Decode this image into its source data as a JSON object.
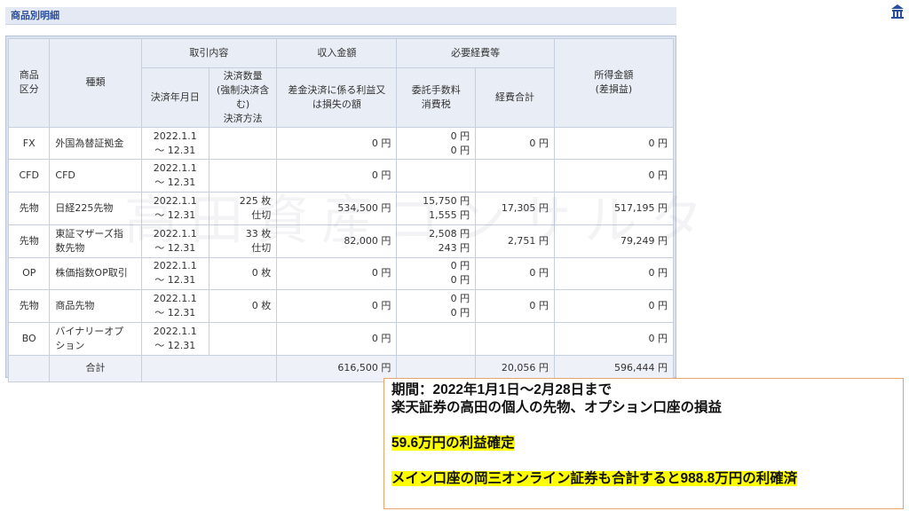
{
  "section_title": "商品別明細",
  "watermark": "高田資産コンサルタ",
  "header": {
    "product_type": "商品\n区分",
    "kind": "種類",
    "trade_content": "取引内容",
    "settle_date": "決済年月日",
    "settle_qty": "決済数量\n(強制決済含む)\n決済方法",
    "revenue": "収入金額",
    "revenue_sub": "差金決済に係る利益又\nは損失の額",
    "expenses": "必要経費等",
    "commission": "委託手数料\n消費税",
    "expense_total": "経費合計",
    "income": "所得金額\n(差損益)"
  },
  "rows": [
    {
      "cat": "FX",
      "kind": "外国為替証拠金",
      "date": "2022.1.1\n～ 12.31",
      "qty": "",
      "revenue": "0 円",
      "commission": "0 円\n0 円",
      "exp_total": "0 円",
      "income": "0 円"
    },
    {
      "cat": "CFD",
      "kind": "CFD",
      "date": "2022.1.1\n～ 12.31",
      "qty": "",
      "revenue": "0 円",
      "commission": "",
      "exp_total": "",
      "income": "0 円"
    },
    {
      "cat": "先物",
      "kind": "日経225先物",
      "date": "2022.1.1\n～ 12.31",
      "qty": "225 枚\n仕切",
      "revenue": "534,500 円",
      "commission": "15,750 円\n1,555 円",
      "exp_total": "17,305 円",
      "income": "517,195 円"
    },
    {
      "cat": "先物",
      "kind": "東証マザーズ指\n数先物",
      "date": "2022.1.1\n～ 12.31",
      "qty": "33 枚\n仕切",
      "revenue": "82,000 円",
      "commission": "2,508 円\n243 円",
      "exp_total": "2,751 円",
      "income": "79,249 円"
    },
    {
      "cat": "OP",
      "kind": "株価指数OP取引",
      "date": "2022.1.1\n～ 12.31",
      "qty": "0 枚",
      "revenue": "0 円",
      "commission": "0 円\n0 円",
      "exp_total": "0 円",
      "income": "0 円"
    },
    {
      "cat": "先物",
      "kind": "商品先物",
      "date": "2022.1.1\n～ 12.31",
      "qty": "0 枚",
      "revenue": "0 円",
      "commission": "0 円\n0 円",
      "exp_total": "0 円",
      "income": "0 円"
    },
    {
      "cat": "BO",
      "kind": "バイナリーオプ\nション",
      "date": "2022.1.1\n～ 12.31",
      "qty": "",
      "revenue": "0 円",
      "commission": "",
      "exp_total": "",
      "income": "0 円"
    }
  ],
  "total": {
    "label": "合計",
    "revenue": "616,500 円",
    "exp_total": "20,056 円",
    "income": "596,444 円"
  },
  "note": {
    "line1": "期間：2022年1月1日～2月28日まで",
    "line2": "楽天証券の高田の個人の先物、オプション口座の損益",
    "line3": "59.6万円の利益確定",
    "line4": "メイン口座の岡三オンライン証券も合計すると988.8万円の利確済"
  },
  "colors": {
    "header_text": "#2a4f9e",
    "highlight": "#ffff00",
    "note_border": "#e8a46a"
  },
  "icons": [
    "building-icon"
  ]
}
